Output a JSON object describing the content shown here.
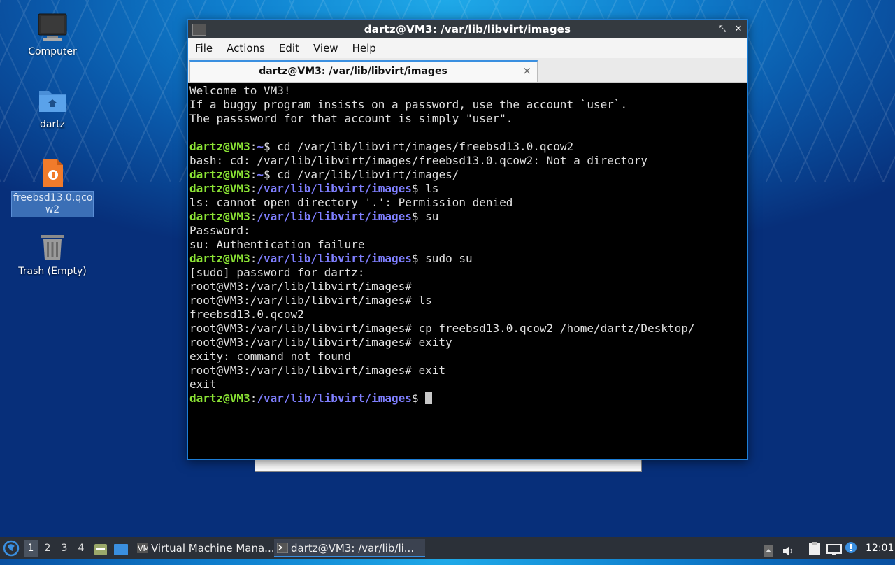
{
  "desktop": {
    "icons": [
      {
        "label": "Computer",
        "icon": "computer-icon"
      },
      {
        "label": "dartz",
        "icon": "home-folder-icon"
      },
      {
        "label": "freebsd13.0.qco\nw2",
        "icon": "file-icon",
        "selected": true
      },
      {
        "label": "Trash (Empty)",
        "icon": "trash-icon"
      }
    ]
  },
  "window": {
    "title": "dartz@VM3: /var/lib/libvirt/images",
    "controls": {
      "minimize": "–",
      "maximize": "⤡",
      "close": "✕"
    },
    "menu": [
      "File",
      "Actions",
      "Edit",
      "View",
      "Help"
    ],
    "tab": {
      "label": "dartz@VM3: /var/lib/libvirt/images",
      "close": "×"
    }
  },
  "terminal": {
    "lines": [
      [
        {
          "t": "Welcome to VM3!"
        }
      ],
      [
        {
          "t": "If a buggy program insists on a password, use the account `user`."
        }
      ],
      [
        {
          "t": "The passsword for that account is simply \"user\"."
        }
      ],
      [
        {
          "t": ""
        }
      ],
      [
        {
          "t": "dartz@VM3",
          "c": "pu"
        },
        {
          "t": ":"
        },
        {
          "t": "~",
          "c": "pp"
        },
        {
          "t": "$ cd /var/lib/libvirt/images/freebsd13.0.qcow2"
        }
      ],
      [
        {
          "t": "bash: cd: /var/lib/libvirt/images/freebsd13.0.qcow2: Not a directory"
        }
      ],
      [
        {
          "t": "dartz@VM3",
          "c": "pu"
        },
        {
          "t": ":"
        },
        {
          "t": "~",
          "c": "pp"
        },
        {
          "t": "$ cd /var/lib/libvirt/images/"
        }
      ],
      [
        {
          "t": "dartz@VM3",
          "c": "pu"
        },
        {
          "t": ":"
        },
        {
          "t": "/var/lib/libvirt/images",
          "c": "pp"
        },
        {
          "t": "$ ls"
        }
      ],
      [
        {
          "t": "ls: cannot open directory '.': Permission denied"
        }
      ],
      [
        {
          "t": "dartz@VM3",
          "c": "pu"
        },
        {
          "t": ":"
        },
        {
          "t": "/var/lib/libvirt/images",
          "c": "pp"
        },
        {
          "t": "$ su"
        }
      ],
      [
        {
          "t": "Password:"
        }
      ],
      [
        {
          "t": "su: Authentication failure"
        }
      ],
      [
        {
          "t": "dartz@VM3",
          "c": "pu"
        },
        {
          "t": ":"
        },
        {
          "t": "/var/lib/libvirt/images",
          "c": "pp"
        },
        {
          "t": "$ sudo su"
        }
      ],
      [
        {
          "t": "[sudo] password for dartz:"
        }
      ],
      [
        {
          "t": "root@VM3:/var/lib/libvirt/images#"
        }
      ],
      [
        {
          "t": "root@VM3:/var/lib/libvirt/images# ls"
        }
      ],
      [
        {
          "t": "freebsd13.0.qcow2"
        }
      ],
      [
        {
          "t": "root@VM3:/var/lib/libvirt/images# cp freebsd13.0.qcow2 /home/dartz/Desktop/"
        }
      ],
      [
        {
          "t": "root@VM3:/var/lib/libvirt/images# exity"
        }
      ],
      [
        {
          "t": "exity: command not found"
        }
      ],
      [
        {
          "t": "root@VM3:/var/lib/libvirt/images# exit"
        }
      ],
      [
        {
          "t": "exit"
        }
      ],
      [
        {
          "t": "dartz@VM3",
          "c": "pu"
        },
        {
          "t": ":"
        },
        {
          "t": "/var/lib/libvirt/images",
          "c": "pp"
        },
        {
          "t": "$ "
        },
        {
          "cursor": true
        }
      ]
    ]
  },
  "taskbar": {
    "workspaces": [
      "1",
      "2",
      "3",
      "4"
    ],
    "active_workspace": "1",
    "tasks": [
      {
        "label": "Virtual Machine Mana...",
        "icon": "virt-manager-icon",
        "active": false
      },
      {
        "label": "dartz@VM3: /var/lib/li...",
        "icon": "terminal-icon",
        "active": true
      }
    ],
    "clock": "12:01"
  }
}
